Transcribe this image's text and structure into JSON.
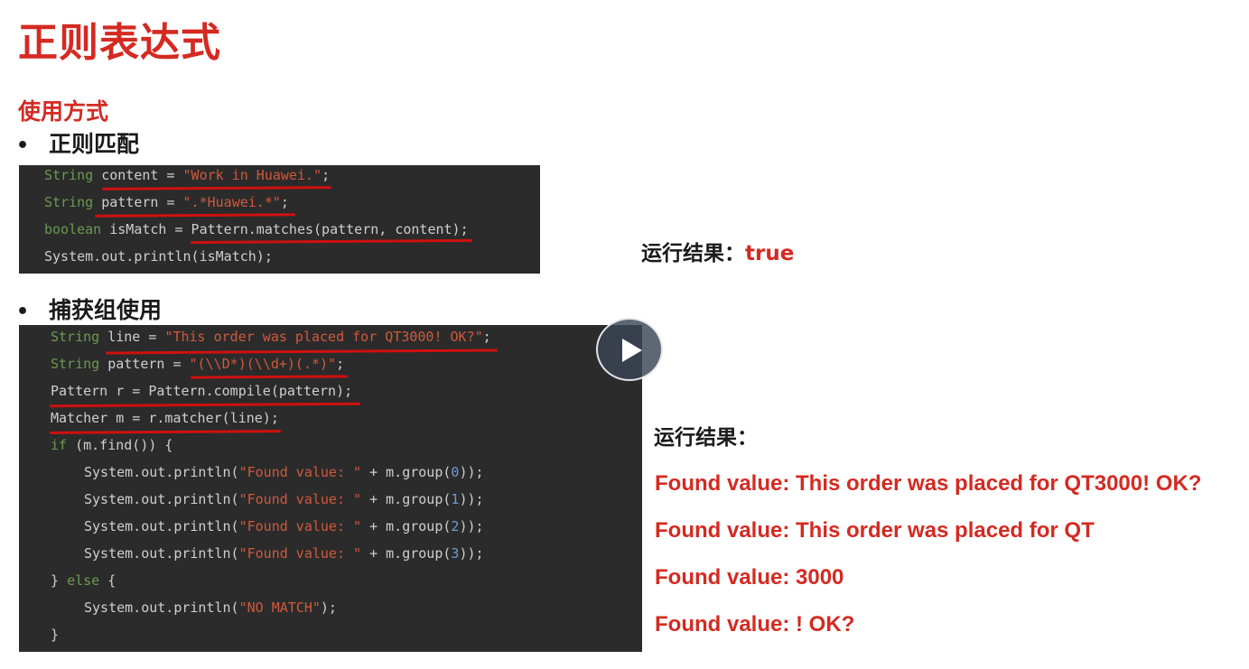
{
  "title": "正则表达式",
  "section_heading": "使用方式",
  "bullet_match": {
    "marker": "•",
    "label": "正则匹配"
  },
  "bullet_group": {
    "marker": "•",
    "label": "捕获组使用"
  },
  "code1": [
    {
      "type": "String",
      "rest": " content = ",
      "str": "\"Work in Huawei.\"",
      "end": ";"
    },
    {
      "type": "String",
      "rest": " pattern = ",
      "str": "\".*Huawei.*\"",
      "end": ";"
    },
    {
      "type": "boolean",
      "rest": " isMatch = Pattern.matches(pattern, content);"
    },
    {
      "plain": "System.out.println(isMatch);"
    }
  ],
  "code2": {
    "l1": {
      "type": "String",
      "rest": " line = ",
      "str": "\"This order was placed for QT3000! OK?\"",
      "end": ";"
    },
    "l2": {
      "type": "String",
      "rest": " pattern = ",
      "str": "\"(\\\\D*)(\\\\d+)(.*)\"",
      "end": ";"
    },
    "l3": "Pattern r = Pattern.compile(pattern);",
    "l4": "Matcher m = r.matcher(line);",
    "l5": {
      "kw": "if",
      "rest": " (m.find()) {"
    },
    "prints": [
      {
        "pre": "System.out.println(",
        "str": "\"Found value: \"",
        "mid": " + m.group(",
        "num": "0",
        "end": "));"
      },
      {
        "pre": "System.out.println(",
        "str": "\"Found value: \"",
        "mid": " + m.group(",
        "num": "1",
        "end": "));"
      },
      {
        "pre": "System.out.println(",
        "str": "\"Found value: \"",
        "mid": " + m.group(",
        "num": "2",
        "end": "));"
      },
      {
        "pre": "System.out.println(",
        "str": "\"Found value: \"",
        "mid": " + m.group(",
        "num": "3",
        "end": "));"
      }
    ],
    "l10": {
      "pre": "} ",
      "kw": "else",
      "rest": " {"
    },
    "l11": {
      "pre": "System.out.println(",
      "str": "\"NO MATCH\"",
      "end": ");"
    },
    "l12": "}"
  },
  "result1": {
    "label": "运行结果：",
    "value": "true"
  },
  "result2": {
    "label": "运行结果：",
    "lines": [
      "Found value: This order was placed for QT3000! OK?",
      "Found value: This order was placed for QT",
      "Found value: 3000",
      "Found value: ! OK?"
    ]
  },
  "colors": {
    "accent_red": "#d42a22",
    "code_bg": "#2b2b2b",
    "underline_red": "#d01010"
  },
  "play_button": {
    "icon": "play-icon"
  }
}
